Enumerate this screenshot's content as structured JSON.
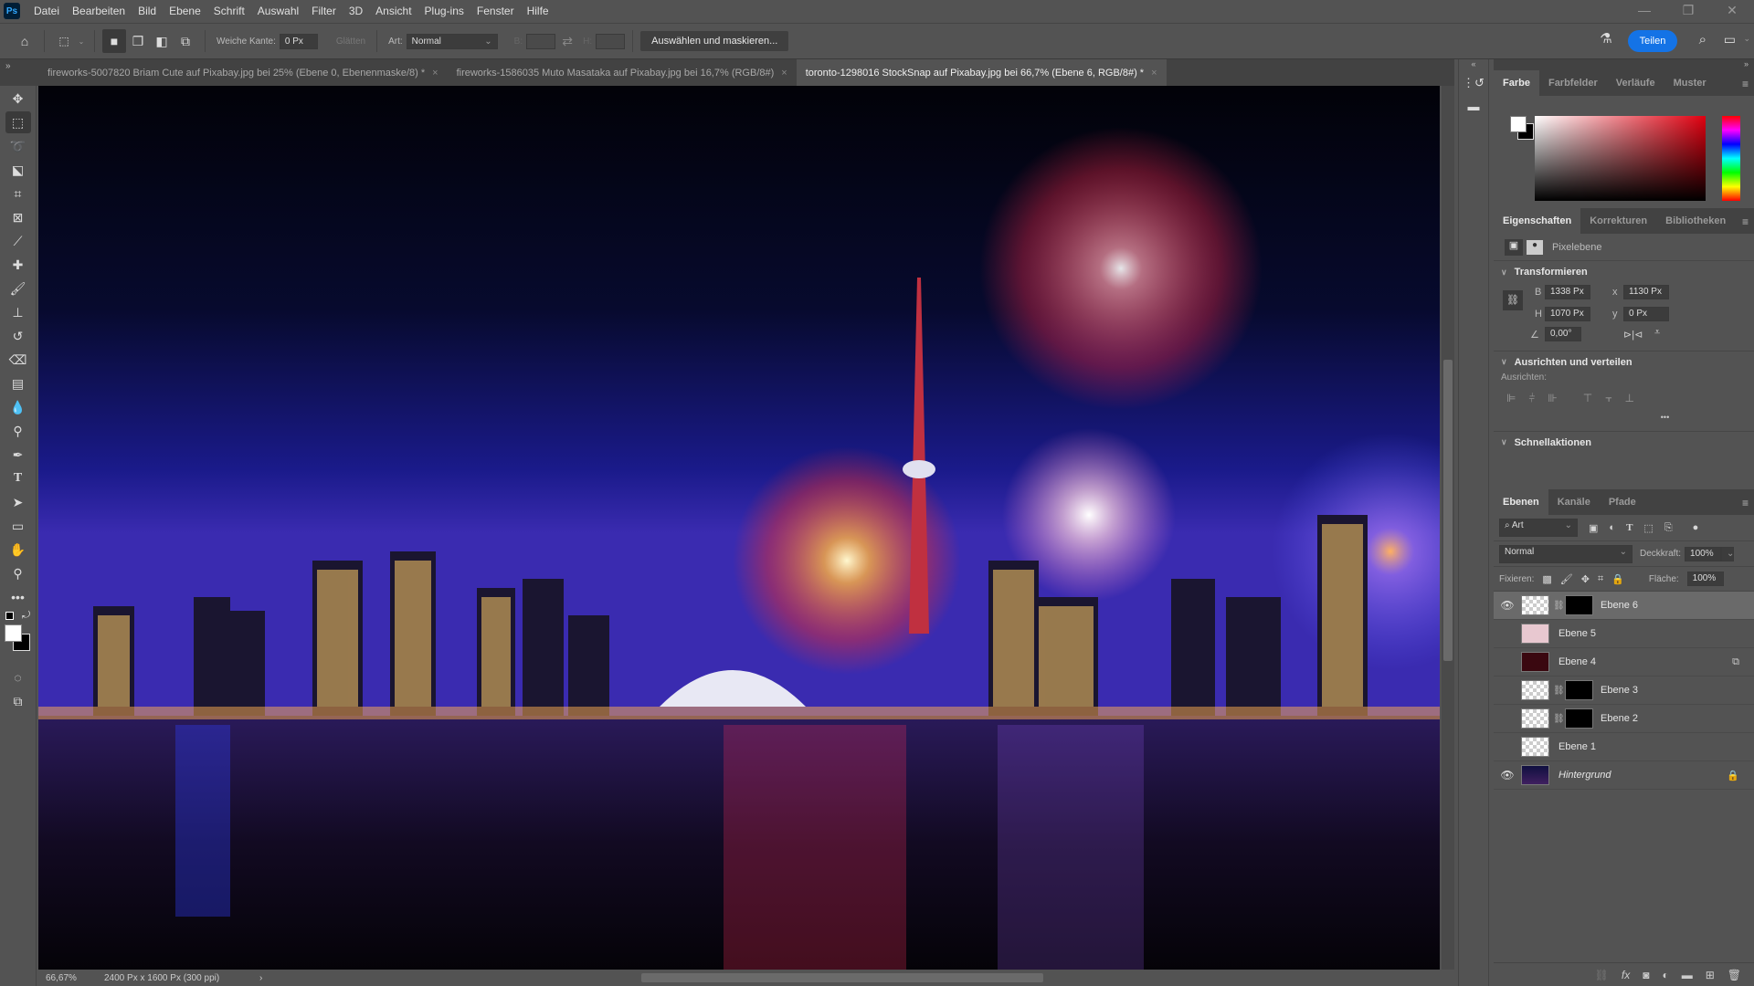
{
  "app": {
    "logo": "Ps"
  },
  "menu": [
    "Datei",
    "Bearbeiten",
    "Bild",
    "Ebene",
    "Schrift",
    "Auswahl",
    "Filter",
    "3D",
    "Ansicht",
    "Plug-ins",
    "Fenster",
    "Hilfe"
  ],
  "window_controls": {
    "minimize": "—",
    "restore": "❐",
    "close": "✕"
  },
  "options_bar": {
    "feather_label": "Weiche Kante:",
    "feather_value": "0 Px",
    "antialias_label": "Glätten",
    "style_label": "Art:",
    "style_value": "Normal",
    "width_label": "B:",
    "height_label": "H:",
    "select_mask_button": "Auswählen und maskieren...",
    "share_button": "Teilen"
  },
  "tabs": [
    {
      "label": "fireworks-5007820 Briam Cute auf Pixabay.jpg bei 25% (Ebene 0, Ebenenmaske/8) *",
      "active": false
    },
    {
      "label": "fireworks-1586035 Muto Masataka auf Pixabay.jpg bei 16,7% (RGB/8#)",
      "active": false
    },
    {
      "label": "toronto-1298016 StockSnap auf Pixabay.jpg bei 66,7% (Ebene 6, RGB/8#) *",
      "active": true
    }
  ],
  "tab_close": "×",
  "status": {
    "zoom": "66,67%",
    "doc_info": "2400 Px x 1600 Px (300 ppi)",
    "arrow": "›"
  },
  "color_panel": {
    "tabs": [
      "Farbe",
      "Farbfelder",
      "Verläufe",
      "Muster"
    ],
    "active_tab": "Farbe",
    "foreground": "#ffffff",
    "background": "#000000",
    "hue_color": "#e00010"
  },
  "properties_panel": {
    "tabs": [
      "Eigenschaften",
      "Korrekturen",
      "Bibliotheken"
    ],
    "layer_type": "Pixelebene",
    "transform": {
      "title": "Transformieren",
      "w_label": "B",
      "w": "1338 Px",
      "h_label": "H",
      "h": "1070 Px",
      "x_label": "x",
      "x": "1130 Px",
      "y_label": "y",
      "y": "0 Px",
      "angle": "0,00°"
    },
    "align": {
      "title": "Ausrichten und verteilen",
      "sub": "Ausrichten:",
      "more": "•••"
    },
    "quick_actions": {
      "title": "Schnellaktionen"
    }
  },
  "layers_panel": {
    "tabs": [
      "Ebenen",
      "Kanäle",
      "Pfade"
    ],
    "filter_value": "Art",
    "blend_mode": "Normal",
    "opacity_label": "Deckkraft:",
    "opacity": "100%",
    "lock_label": "Fixieren:",
    "fill_label": "Fläche:",
    "fill": "100%",
    "layers": [
      {
        "name": "Ebene 6",
        "visible": true,
        "selected": true,
        "mask": true,
        "italic": false
      },
      {
        "name": "Ebene 5",
        "visible": false,
        "selected": false,
        "mask": false,
        "italic": false
      },
      {
        "name": "Ebene 4",
        "visible": false,
        "selected": false,
        "mask": false,
        "italic": false,
        "badge": "smart-object"
      },
      {
        "name": "Ebene 3",
        "visible": false,
        "selected": false,
        "mask": true,
        "italic": false
      },
      {
        "name": "Ebene 2",
        "visible": false,
        "selected": false,
        "mask": true,
        "italic": false
      },
      {
        "name": "Ebene 1",
        "visible": false,
        "selected": false,
        "mask": false,
        "italic": false
      },
      {
        "name": "Hintergrund",
        "visible": true,
        "selected": false,
        "mask": false,
        "italic": true,
        "badge": "lock"
      }
    ]
  }
}
